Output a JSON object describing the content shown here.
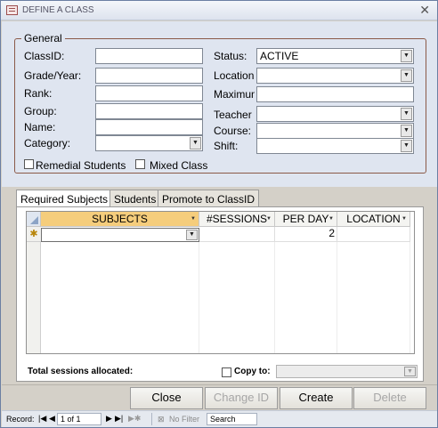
{
  "window": {
    "title": "DEFINE A CLASS",
    "close_glyph": "✕"
  },
  "general": {
    "legend": "General",
    "labels": {
      "class_id": "ClassID:",
      "grade_year": "Grade/Year:",
      "rank": "Rank:",
      "group": "Group:",
      "name": "Name:",
      "category": "Category:",
      "status": "Status:",
      "location": "Location",
      "maximum": "Maximum",
      "teacher": "Teacher",
      "course": "Course:",
      "shift": "Shift:"
    },
    "values": {
      "class_id": "",
      "grade_year": "",
      "rank": "",
      "group": "",
      "name": "",
      "category": "",
      "status": "ACTIVE",
      "location": "",
      "maximum": "",
      "teacher": "",
      "course": "",
      "shift": ""
    },
    "checkboxes": {
      "remedial": {
        "label": "Remedial Students",
        "checked": false
      },
      "mixed": {
        "label": "Mixed Class",
        "checked": false
      }
    }
  },
  "tabs": [
    "Required Subjects",
    "Students",
    "Promote to ClassID"
  ],
  "subjects_grid": {
    "columns": [
      "SUBJECTS",
      "#SESSIONS",
      "PER DAY",
      "LOCATION"
    ],
    "new_row": {
      "marker": "✱",
      "subject": "",
      "sessions": "",
      "per_day": "2",
      "location": ""
    }
  },
  "footer_panel": {
    "total_label": "Total sessions allocated:",
    "copy_to_label": "Copy to:",
    "copy_to_value": ""
  },
  "buttons": {
    "close": "Close",
    "change_id": "Change ID",
    "create": "Create",
    "delete": "Delete"
  },
  "navigation": {
    "record_label": "Record:",
    "position": "1 of 1",
    "filter": "No Filter",
    "search_placeholder": "Search"
  }
}
